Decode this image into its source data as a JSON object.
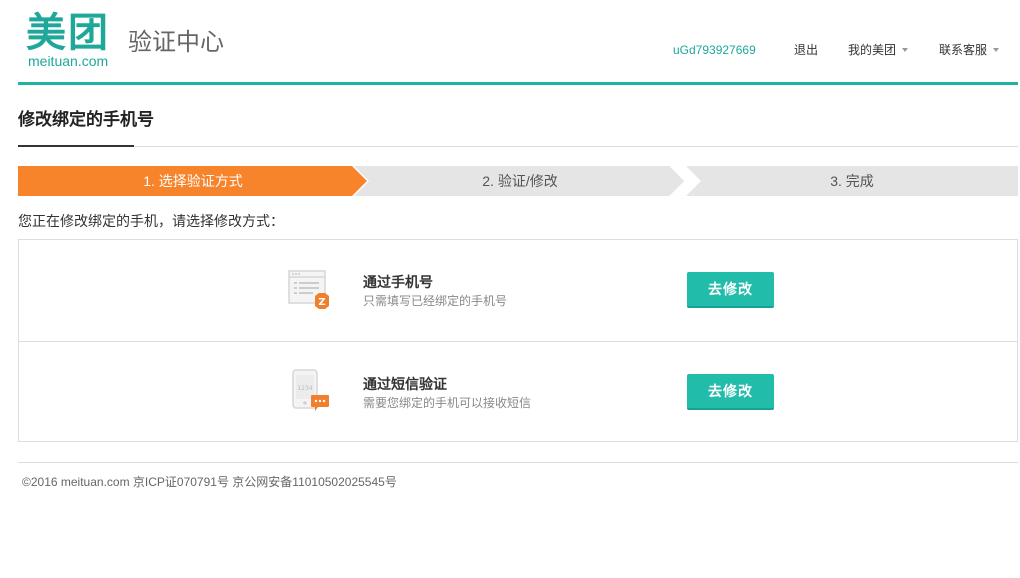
{
  "header": {
    "logo_cn": "美团",
    "logo_en": "meituan.com",
    "subtitle": "验证中心",
    "username": "uGd793927669",
    "logout": "退出",
    "my_meituan": "我的美团",
    "customer_service": "联系客服"
  },
  "page": {
    "title": "修改绑定的手机号",
    "intro": "您正在修改绑定的手机，请选择修改方式："
  },
  "steps": [
    {
      "label": "1. 选择验证方式",
      "active": true
    },
    {
      "label": "2. 验证/修改",
      "active": false
    },
    {
      "label": "3. 完成",
      "active": false
    }
  ],
  "options": [
    {
      "icon": "phone-form-icon",
      "title": "通过手机号",
      "desc": "只需填写已经绑定的手机号",
      "button": "去修改"
    },
    {
      "icon": "sms-phone-icon",
      "title": "通过短信验证",
      "desc": "需要您绑定的手机可以接收短信",
      "button": "去修改"
    }
  ],
  "footer": {
    "text": "©2016 meituan.com 京ICP证070791号 京公网安备11010502025545号"
  },
  "colors": {
    "brand": "#1fa79a",
    "step_active": "#f7832b",
    "step_inactive": "#e5e5e5",
    "button": "#22bcaa"
  }
}
